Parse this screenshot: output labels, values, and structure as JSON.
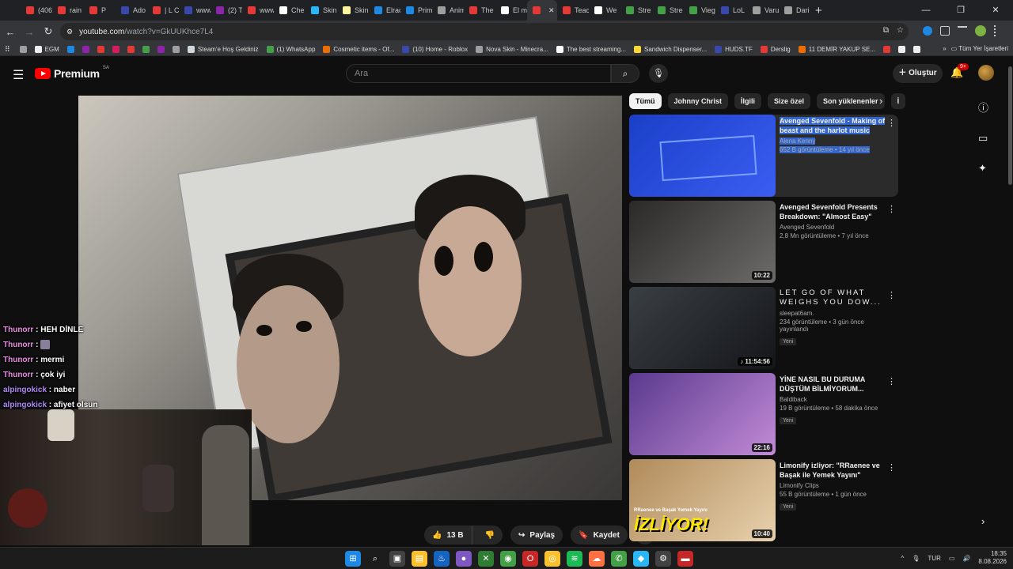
{
  "browser": {
    "tabs": [
      {
        "title": "(406",
        "color": "#e53935"
      },
      {
        "title": "rain",
        "color": "#e53935"
      },
      {
        "title": "P",
        "color": "#e53935"
      },
      {
        "title": "Ado",
        "color": "#3949ab"
      },
      {
        "title": "| L C",
        "color": "#e53935"
      },
      {
        "title": "www.",
        "color": "#3949ab"
      },
      {
        "title": "(2) T",
        "color": "#8e24aa"
      },
      {
        "title": "www.",
        "color": "#e53935"
      },
      {
        "title": "Che",
        "color": "#ffffff"
      },
      {
        "title": "Skin",
        "color": "#29b6f6"
      },
      {
        "title": "Skin",
        "color": "#fff59d"
      },
      {
        "title": "Elrac",
        "color": "#1e88e5"
      },
      {
        "title": "Prim",
        "color": "#1e88e5"
      },
      {
        "title": "Anim",
        "color": "#9e9e9e"
      },
      {
        "title": "The",
        "color": "#e53935"
      },
      {
        "title": "El m",
        "color": "#ffffff"
      },
      {
        "title": "",
        "color": "#e53935",
        "active": true
      },
      {
        "title": "Teac",
        "color": "#e53935"
      },
      {
        "title": "We",
        "color": "#ffffff"
      },
      {
        "title": "Stre",
        "color": "#43a047"
      },
      {
        "title": "Stre",
        "color": "#43a047"
      },
      {
        "title": "Vieg",
        "color": "#43a047"
      },
      {
        "title": "LoL",
        "color": "#3949ab"
      },
      {
        "title": "Varu",
        "color": "#9e9e9e"
      },
      {
        "title": "Dari",
        "color": "#9e9e9e"
      }
    ],
    "new_tab": "+",
    "url_host": "youtube.com",
    "url_path": "/watch?v=GkUUKhce7L4",
    "bookmarks": [
      {
        "label": "",
        "color": "#9e9e9e"
      },
      {
        "label": "EGM",
        "color": "#eeeeee"
      },
      {
        "label": "",
        "color": "#1e88e5"
      },
      {
        "label": "",
        "color": "#8e24aa"
      },
      {
        "label": "",
        "color": "#e53935"
      },
      {
        "label": "",
        "color": "#d81b60"
      },
      {
        "label": "",
        "color": "#e53935"
      },
      {
        "label": "",
        "color": "#43a047"
      },
      {
        "label": "",
        "color": "#8e24aa"
      },
      {
        "label": "",
        "color": "#9e9e9e"
      },
      {
        "label": "Steam'e Hoş Geldiniz",
        "color": "#cfd8dc"
      },
      {
        "label": "(1) WhatsApp",
        "color": "#43a047"
      },
      {
        "label": "Cosmetic items - Of...",
        "color": "#ef6c00"
      },
      {
        "label": "(10) Home - Roblox",
        "color": "#3949ab"
      },
      {
        "label": "Nova Skin - Minecra...",
        "color": "#9e9e9e"
      },
      {
        "label": "The best streaming...",
        "color": "#ffffff"
      },
      {
        "label": "Sandwich Dispenser...",
        "color": "#fdd835"
      },
      {
        "label": "HUDS.TF",
        "color": "#3949ab"
      },
      {
        "label": "Derslig",
        "color": "#e53935"
      },
      {
        "label": "11 DEMİR YAKUP SE...",
        "color": "#ef6c00"
      },
      {
        "label": "",
        "color": "#e53935"
      },
      {
        "label": "",
        "color": "#eeeeee"
      },
      {
        "label": "",
        "color": "#eeeeee"
      }
    ],
    "all_bookmarks": "Tüm Yer İşaretleri"
  },
  "youtube": {
    "brand": "Premium",
    "brand_region": "SA",
    "search_placeholder": "Ara",
    "create_label": "Oluştur",
    "notif_badge": "9+",
    "chips": [
      "Tümü",
      "Johnny Christ",
      "İlgili",
      "Size özel",
      "Son yüklenenler",
      "İ"
    ],
    "actions": {
      "likes": "13 B",
      "share": "Paylaş",
      "save": "Kaydet",
      "more": "•••"
    },
    "recommendations": [
      {
        "title": "Avenged Sevenfold - Making of beast and the harlot music vide...",
        "channel": "Alena Kenny",
        "stats": "652 B görüntüleme • 14 yıl önce",
        "duration": "",
        "new": "",
        "thumb_colors": [
          "#1a3fc7",
          "#3b5ef2"
        ],
        "thumb_text": "",
        "highlight": true,
        "spaced": false
      },
      {
        "title": "Avenged Sevenfold Presents Breakdown: \"Almost Easy\"",
        "channel": "Avenged Sevenfold",
        "stats": "2,8 Mn görüntüleme • 7 yıl önce",
        "duration": "10:22",
        "new": "",
        "thumb_colors": [
          "#2b2a29",
          "#6d6b68"
        ],
        "thumb_text": "",
        "highlight": false,
        "spaced": false
      },
      {
        "title": "LET GO OF WHAT WEIGHS YOU DOW...",
        "channel": "sleepat6am.",
        "stats": "234 görüntüleme • 3 gün önce yayınlandı",
        "duration": "♪ 11:54:56",
        "new": "Yeni",
        "thumb_colors": [
          "#3a3f44",
          "#14161a"
        ],
        "thumb_text": "",
        "highlight": false,
        "spaced": true
      },
      {
        "title": "YİNE NASIL BU DURUMA DÜŞTÜM BİLMİYORUM...",
        "channel": "Baldiback",
        "stats": "19 B görüntüleme • 58 dakika önce",
        "duration": "22:16",
        "new": "Yeni",
        "thumb_colors": [
          "#5a3a8e",
          "#c28bd6"
        ],
        "thumb_text": "",
        "highlight": false,
        "spaced": false
      },
      {
        "title": "Limonify izliyor: \"RRaenee ve Başak ile Yemek Yayını\"",
        "channel": "Limonify Clips",
        "stats": "55 B görüntüleme • 1 gün önce",
        "duration": "10:40",
        "new": "Yeni",
        "thumb_colors": [
          "#b08a5a",
          "#e8d2ae"
        ],
        "thumb_text": "İZLİYOR!",
        "thumb_subtext": "RRaenee ve Başak Yemek Yayını",
        "highlight": false,
        "spaced": false
      }
    ]
  },
  "chat": [
    {
      "user": "Thunorr",
      "msg": "HEH DİNLE",
      "color": "#e88ee0"
    },
    {
      "user": "Thunorr",
      "msg": "",
      "color": "#e88ee0",
      "emote": true
    },
    {
      "user": "Thunorr",
      "msg": "mermi",
      "color": "#e88ee0"
    },
    {
      "user": "Thunorr",
      "msg": "çok iyi",
      "color": "#e88ee0"
    },
    {
      "user": "alpingokick",
      "msg": "naber",
      "color": "#b089f5"
    },
    {
      "user": "alpingokick",
      "msg": "afiyet olsun",
      "color": "#b089f5"
    }
  ],
  "taskbar": {
    "apps": [
      {
        "color": "#1e88e5",
        "glyph": "⊞"
      },
      {
        "color": "transparent",
        "glyph": "⌕"
      },
      {
        "color": "#424242",
        "glyph": "▣"
      },
      {
        "color": "#fbc02d",
        "glyph": "▤"
      },
      {
        "color": "#1565c0",
        "glyph": "♨"
      },
      {
        "color": "#7e57c2",
        "glyph": "●"
      },
      {
        "color": "#2e7d32",
        "glyph": "✕"
      },
      {
        "color": "#43a047",
        "glyph": "◉"
      },
      {
        "color": "#c62828",
        "glyph": "O"
      },
      {
        "color": "#fbc02d",
        "glyph": "◎"
      },
      {
        "color": "#1db954",
        "glyph": "≋"
      },
      {
        "color": "#ff7043",
        "glyph": "☁"
      },
      {
        "color": "#43a047",
        "glyph": "✆"
      },
      {
        "color": "#29b6f6",
        "glyph": "◆"
      },
      {
        "color": "#424242",
        "glyph": "⚙"
      },
      {
        "color": "#c62828",
        "glyph": "▬"
      }
    ],
    "lang": "TUR",
    "time": "18:35",
    "date": "8.08.2026"
  }
}
